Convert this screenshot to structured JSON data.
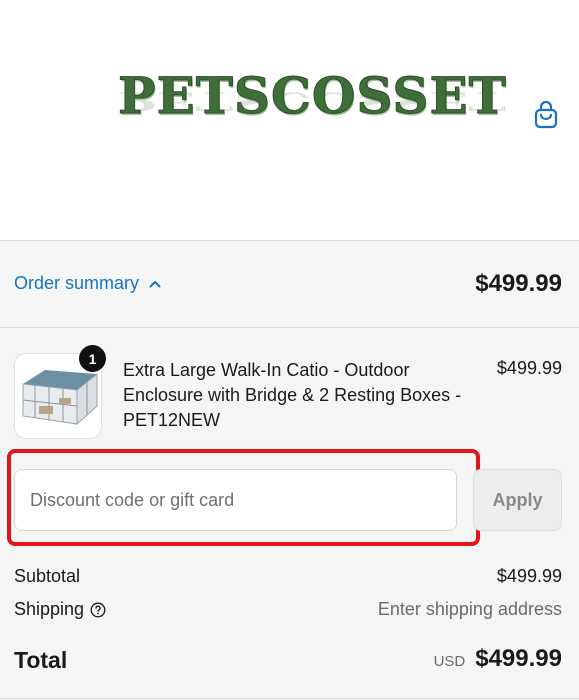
{
  "header": {
    "logo_text": "PETSCOSSET",
    "cart_icon": "shopping-bag-icon"
  },
  "summary": {
    "toggle_label": "Order summary",
    "toggle_icon": "chevron-up-icon",
    "total": "$499.99"
  },
  "product": {
    "quantity": "1",
    "title": "Extra Large Walk-In Catio - Outdoor Enclosure with Bridge & 2 Resting Boxes - PET12NEW",
    "price": "$499.99"
  },
  "discount": {
    "placeholder": "Discount code or gift card",
    "apply_label": "Apply"
  },
  "lines": {
    "subtotal_label": "Subtotal",
    "subtotal_value": "$499.99",
    "shipping_label": "Shipping",
    "shipping_value": "Enter shipping address",
    "total_label": "Total",
    "currency": "USD",
    "total_value": "$499.99"
  },
  "colors": {
    "link": "#1773c6",
    "highlight": "#e0161b",
    "brand_green": "#3f6e3a"
  }
}
